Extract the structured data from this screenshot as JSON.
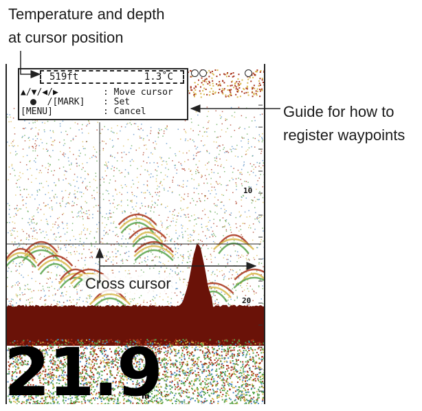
{
  "callouts": {
    "temperature_depth_line1": "Temperature and depth",
    "temperature_depth_line2": "at cursor position",
    "guide_line1": "Guide for how to",
    "guide_line2": "register waypoints",
    "cross_cursor": "Cross cursor"
  },
  "readout": {
    "depth": "519ft",
    "temperature": "1.3˚C"
  },
  "guide": [
    {
      "key": "▲/▼/◀/▶",
      "sep": ":",
      "action": "Move cursor"
    },
    {
      "key": "  /[MARK]",
      "sep": ":",
      "action": "Set"
    },
    {
      "key": "[MENU]",
      "sep": ":",
      "action": "Cancel"
    }
  ],
  "display": {
    "depth_value": "21.9",
    "depth_unit": "m",
    "scale_10": "10",
    "scale_20": "20"
  },
  "colors": {
    "seabed": "#6a1208",
    "echo_red": "#a8321a",
    "echo_yellow": "#d8b74a",
    "echo_green": "#58a34a",
    "echo_blue": "#4a86c0"
  }
}
